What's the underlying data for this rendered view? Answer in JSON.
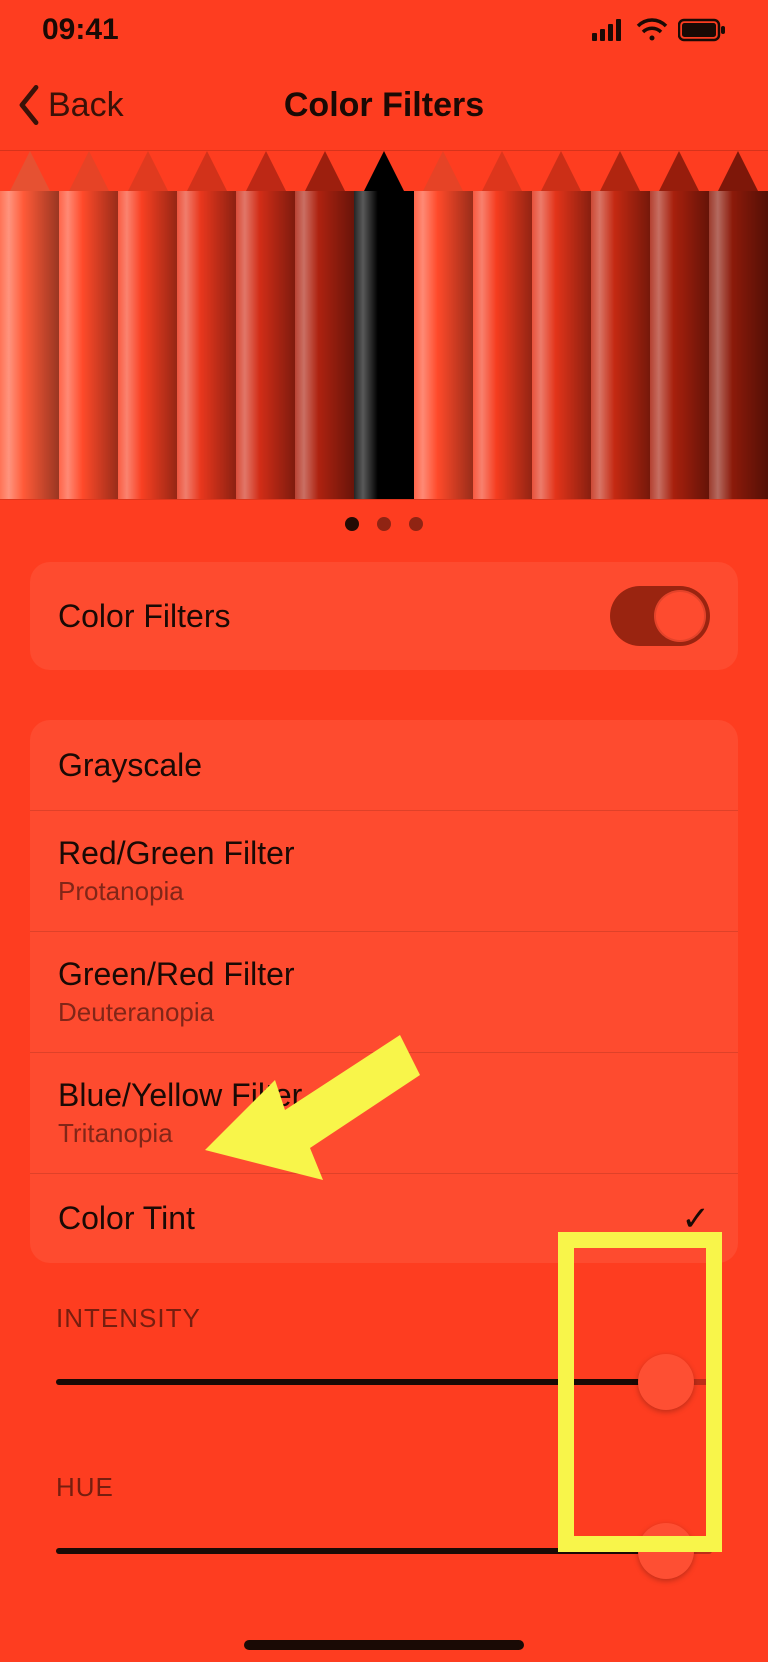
{
  "status": {
    "time": "09:41"
  },
  "nav": {
    "back": "Back",
    "title": "Color Filters"
  },
  "preview": {
    "pencil_colors": [
      "#ff5a38",
      "#ff4a2a",
      "#f94022",
      "#e9371d",
      "#d22d17",
      "#ae2210",
      "#000000",
      "#ff4a2a",
      "#f53c1f",
      "#e3341a",
      "#c42912",
      "#a8200d",
      "#8c1a0a"
    ],
    "page_count": 3,
    "active_page": 0
  },
  "toggle_row": {
    "label": "Color Filters",
    "on": true
  },
  "filters": {
    "items": [
      {
        "title": "Grayscale",
        "sub": ""
      },
      {
        "title": "Red/Green Filter",
        "sub": "Protanopia"
      },
      {
        "title": "Green/Red Filter",
        "sub": "Deuteranopia"
      },
      {
        "title": "Blue/Yellow Filter",
        "sub": "Tritanopia"
      },
      {
        "title": "Color Tint",
        "sub": ""
      }
    ],
    "selected_index": 4
  },
  "sliders": {
    "intensity": {
      "header": "INTENSITY",
      "value": 0.93
    },
    "hue": {
      "header": "HUE",
      "value": 0.93
    }
  }
}
